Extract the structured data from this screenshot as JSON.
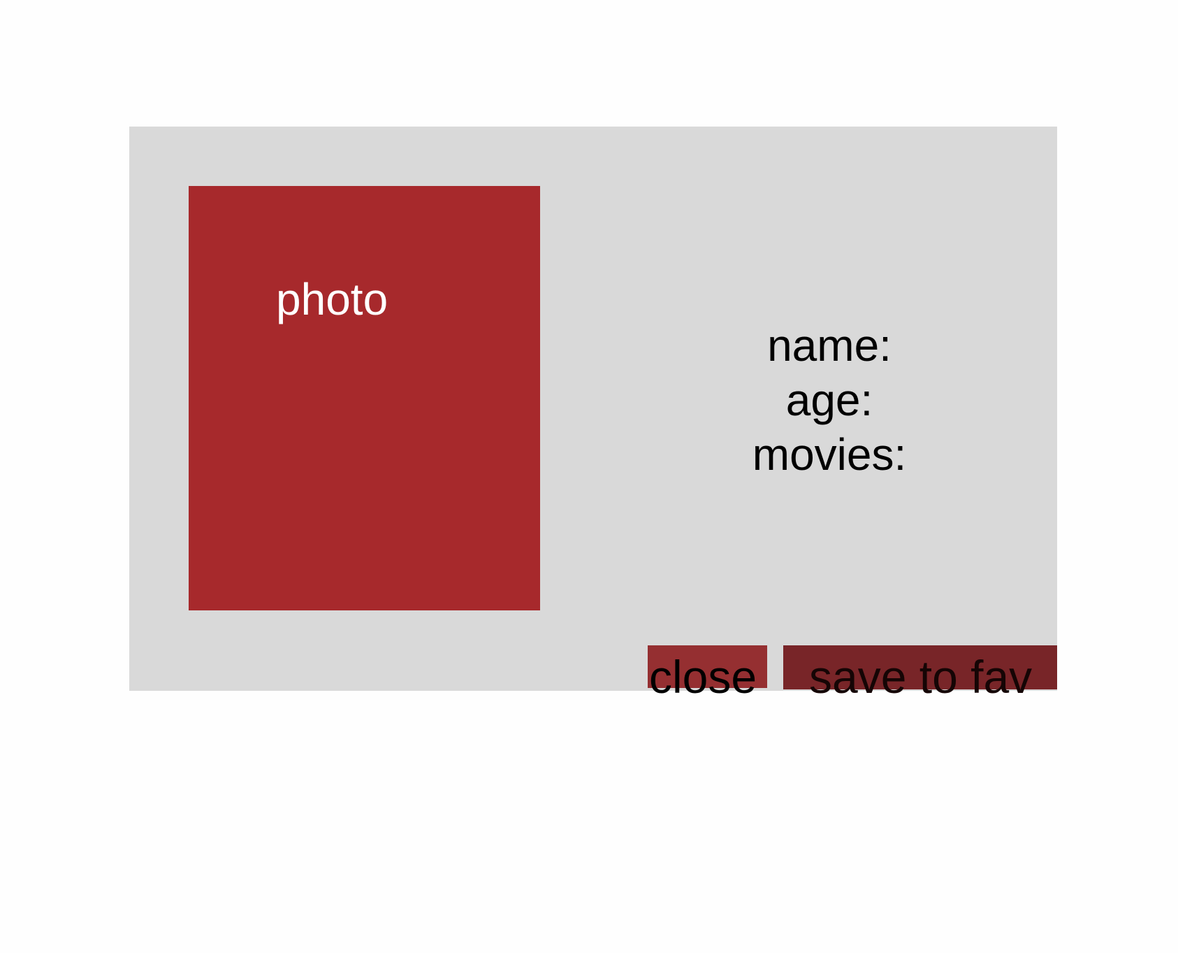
{
  "card": {
    "photo_label": "photo",
    "fields": [
      "name:",
      "age:",
      "movies:"
    ],
    "buttons": {
      "close": "close",
      "save": "save to fav"
    }
  },
  "colors": {
    "panel": "#d9d9d9",
    "photo": "#a7292c",
    "close": "#952f31",
    "save": "#782528"
  }
}
